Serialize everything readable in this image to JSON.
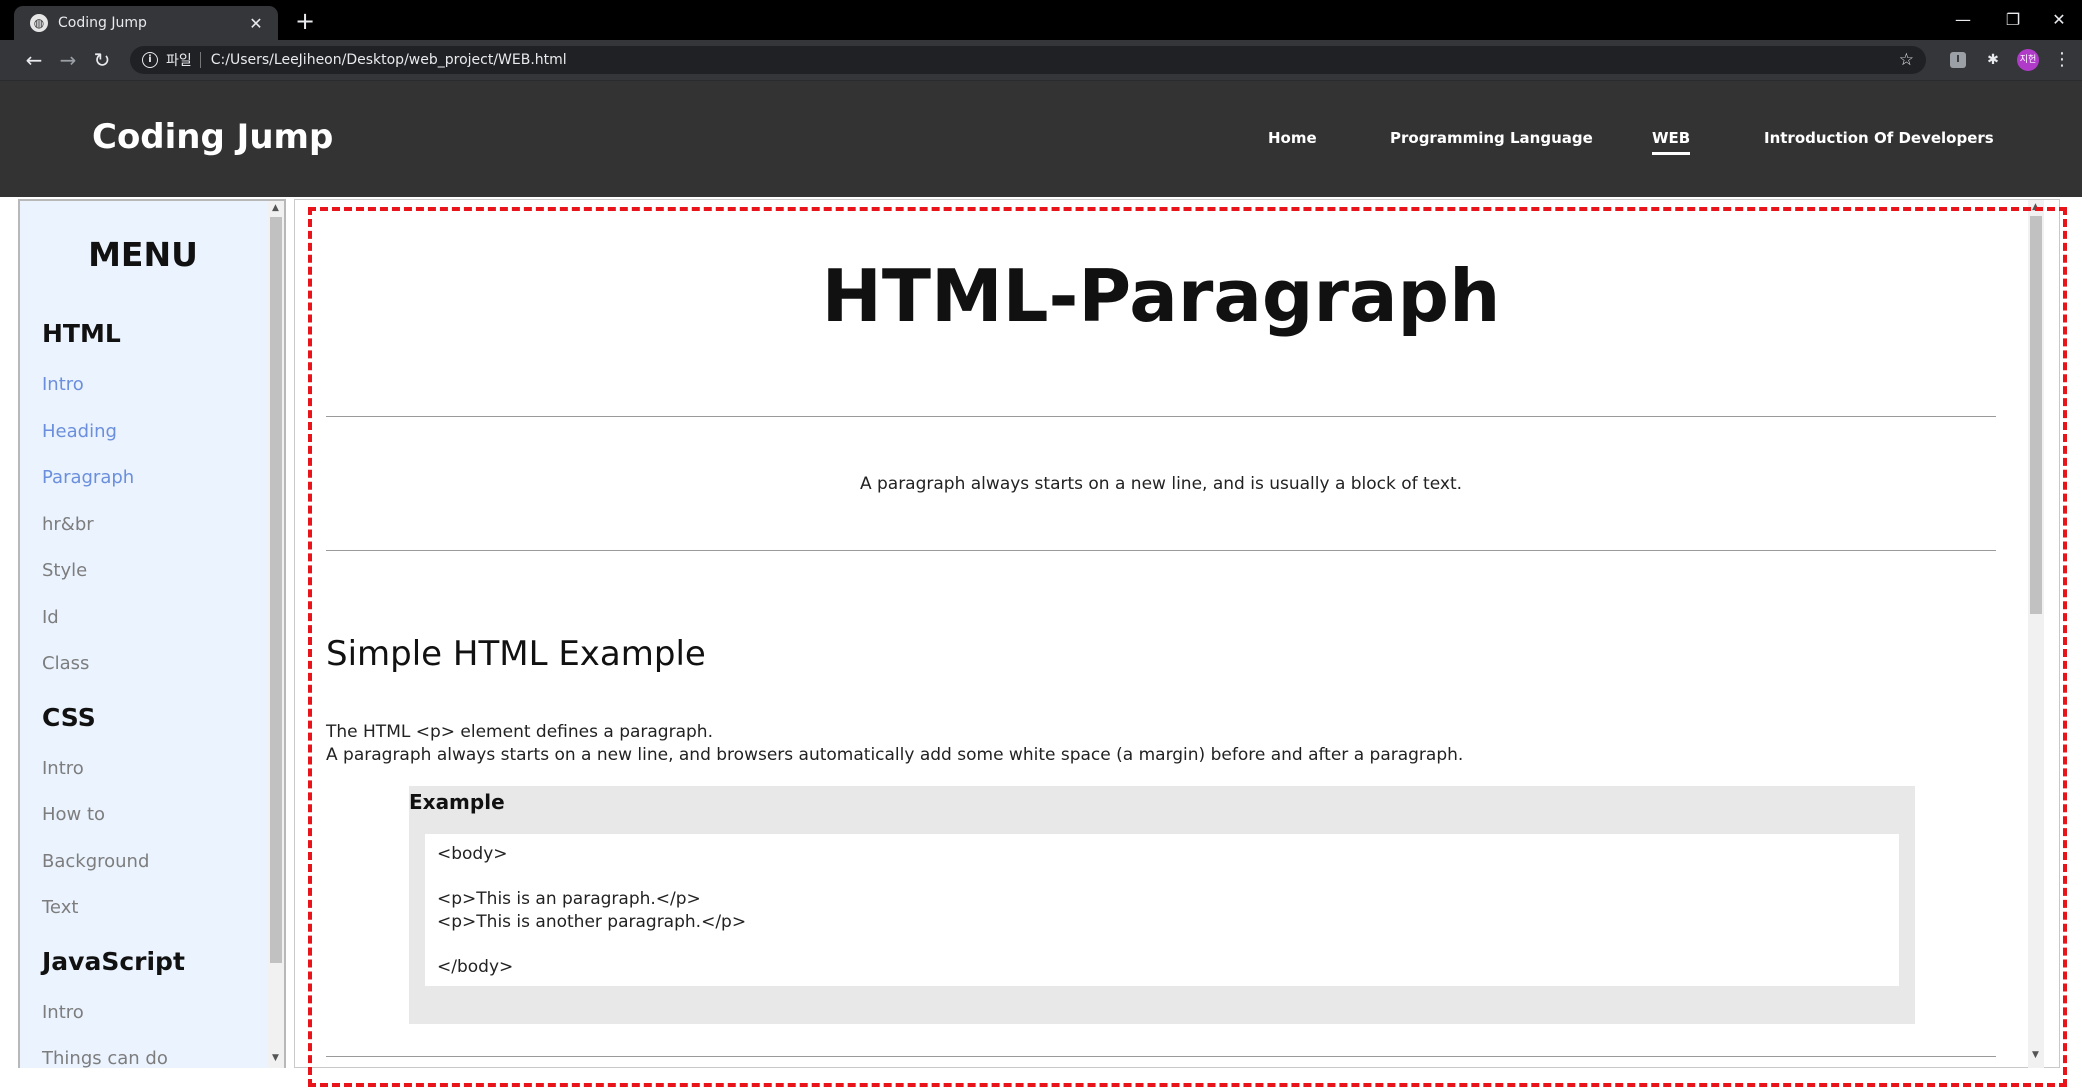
{
  "browser": {
    "tab_title": "Coding Jump",
    "tab_close": "✕",
    "new_tab": "+",
    "scheme_label": "파일",
    "url": "C:/Users/LeeJiheon/Desktop/web_project/WEB.html",
    "avatar_label": "지헌",
    "window": {
      "minimize": "—",
      "restore": "❐",
      "close": "✕"
    }
  },
  "site": {
    "brand": "Coding Jump",
    "nav": [
      "Home",
      "Programming Language",
      "WEB",
      "Introduction Of Developers"
    ],
    "active_nav": "WEB"
  },
  "sidebar": {
    "title": "MENU",
    "sections": [
      {
        "title": "HTML",
        "items": [
          "Intro",
          "Heading",
          "Paragraph",
          "hr&br",
          "Style",
          "Id",
          "Class"
        ]
      },
      {
        "title": "CSS",
        "items": [
          "Intro",
          "How to",
          "Background",
          "Text"
        ]
      },
      {
        "title": "JavaScript",
        "items": [
          "Intro",
          "Things can do"
        ]
      }
    ]
  },
  "content": {
    "title": "HTML-Paragraph",
    "lead": "A paragraph always starts on a new line, and is usually a block of text.",
    "section_title": "Simple HTML Example",
    "body_line1": "The HTML <p> element defines a paragraph.",
    "body_line2": "A paragraph always starts on a new line, and browsers automatically add some white space (a margin) before and after a paragraph.",
    "example_title": "Example",
    "code_lines": [
      "<body>",
      "",
      "<p>This is an paragraph.</p>",
      "<p>This is another paragraph.</p>",
      "",
      "</body>"
    ]
  },
  "colors": {
    "header_bg": "#333333",
    "sidebar_bg": "#eaf3fe",
    "visited_link": "#6b8fdc",
    "link": "#7d7d7d",
    "highlight_border": "#e8141a"
  }
}
